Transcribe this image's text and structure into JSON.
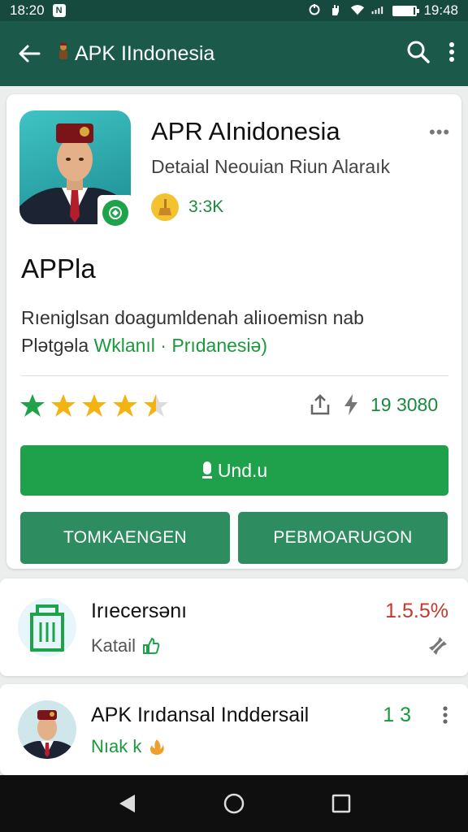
{
  "status_bar": {
    "time_left": "18:20",
    "time_right": "19:48",
    "notification_glyph": "N",
    "battery_level": 0.9
  },
  "app_bar": {
    "title": "APK IIndonesia",
    "flag_icon": "figure-emoji-icon",
    "back_icon": "arrow-left-icon",
    "search_icon": "search-icon",
    "menu_icon": "more-vertical-icon"
  },
  "app": {
    "name": "APR AInidonesia",
    "developer": "Detaial Neouian Riun Alaraık",
    "downloads": "3:3K",
    "section_title": "APPla",
    "description_line1": "Rıeniglsan doagumldenah aliıoemisn nab",
    "description_line2_prefix": "Plətgəla ",
    "description_line2_highlight": "Wklanıl · Prıdanesiə)",
    "rating": 4.5,
    "stat_value": "19 3080",
    "install_label": "Und.u",
    "button_left": "TOMKAENGEN",
    "button_right": "PEBMOARUGON",
    "brand_green": "#1ea14a",
    "secondary_green": "#2e8c61",
    "appbar_color": "#1b5a4b"
  },
  "list": [
    {
      "title": "Irıecersənı",
      "subtitle": "Katail",
      "meta": "1.5.5%",
      "meta_color": "#c43a2e",
      "action_icon": "pin-off-icon"
    },
    {
      "title": "APK Irıdansal Inddersail",
      "subtitle": "Nıak k",
      "meta": "1 3",
      "meta_color": "#1a9a3d",
      "action_icon": "more-vertical-icon"
    }
  ],
  "nav": {
    "back": "triangle-back-icon",
    "home": "circle-home-icon",
    "recents": "square-recents-icon"
  }
}
